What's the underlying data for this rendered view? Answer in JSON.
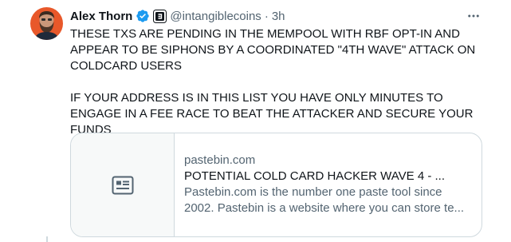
{
  "author": {
    "display_name": "Alex Thorn",
    "handle": "@intangiblecoins",
    "separator": "·",
    "time_ago": "3h",
    "avatar_icon": "bearded-man-avatar",
    "verified_icon": "verified-badge-icon",
    "affiliation_icon": "affiliate-logo-icon"
  },
  "tweet": {
    "paragraph_1": "THESE TXS ARE PENDING IN THE MEMPOOL WITH RBF OPT-IN AND APPEAR TO BE SIPHONS BY A COORDINATED \"4TH WAVE\" ATTACK ON COLDCARD USERS",
    "paragraph_2": "IF YOUR ADDRESS IS IN THIS LIST YOU HAVE ONLY MINUTES TO ENGAGE IN A FEE RACE TO BEAT THE ATTACKER AND SECURE YOUR FUNDS"
  },
  "card": {
    "domain": "pastebin.com",
    "title": "POTENTIAL COLD CARD HACKER WAVE 4 - ...",
    "description_line_1": "Pastebin.com is the number one paste tool since",
    "description_line_2": "2002. Pastebin is a website where you can store te...",
    "thumb_icon": "article-icon"
  },
  "colors": {
    "text_primary": "#0f1419",
    "text_secondary": "#536471",
    "border": "#cfd9de",
    "verified_blue": "#1d9bf0"
  }
}
